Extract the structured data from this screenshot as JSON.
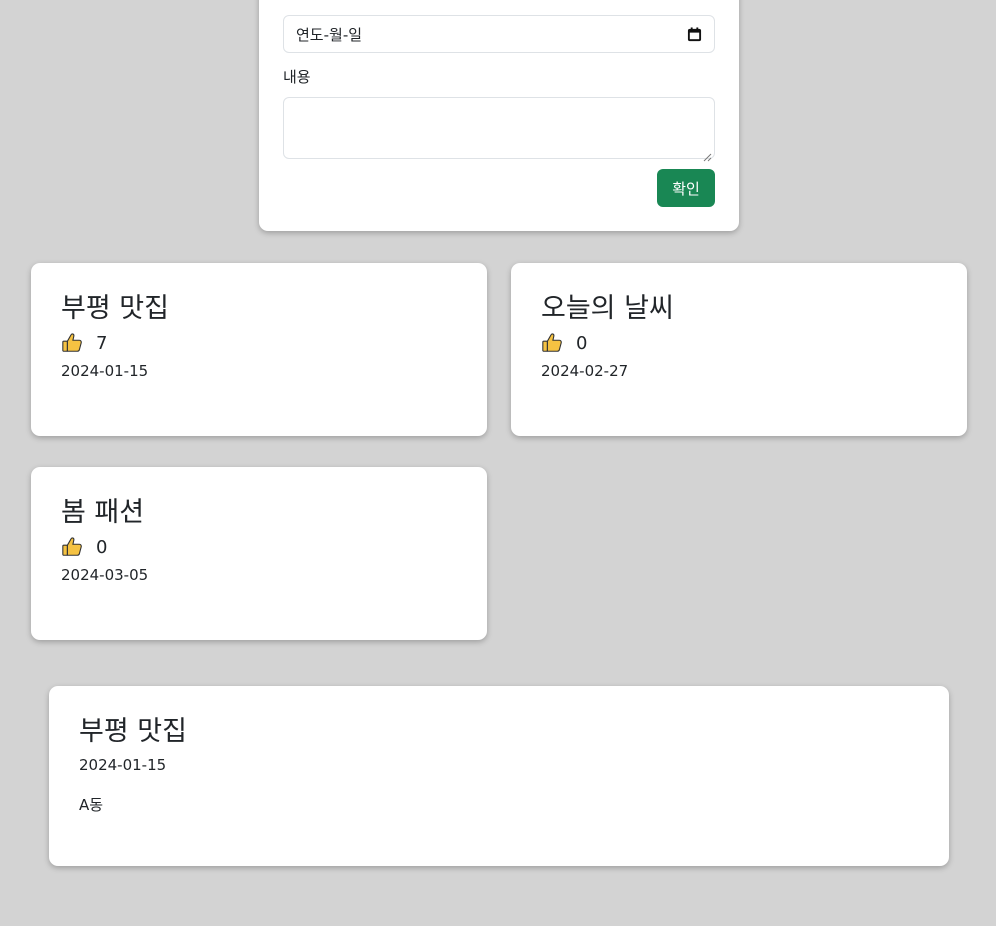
{
  "form": {
    "date_placeholder": "연도-월-일",
    "content_label": "내용",
    "content_value": "",
    "confirm_label": "확인"
  },
  "posts": [
    {
      "title": "부평 맛집",
      "likes": "7",
      "date": "2024-01-15"
    },
    {
      "title": "오늘의 날씨",
      "likes": "0",
      "date": "2024-02-27"
    },
    {
      "title": "봄 패션",
      "likes": "0",
      "date": "2024-03-05"
    }
  ],
  "detail": {
    "title": "부평 맛집",
    "date": "2024-01-15",
    "content": "A동"
  },
  "icons": {
    "like": "thumbs-up-icon",
    "calendar": "calendar-icon"
  },
  "colors": {
    "background": "#d3d3d3",
    "confirm_button": "#198754",
    "thumb_fill": "#f5c242"
  }
}
